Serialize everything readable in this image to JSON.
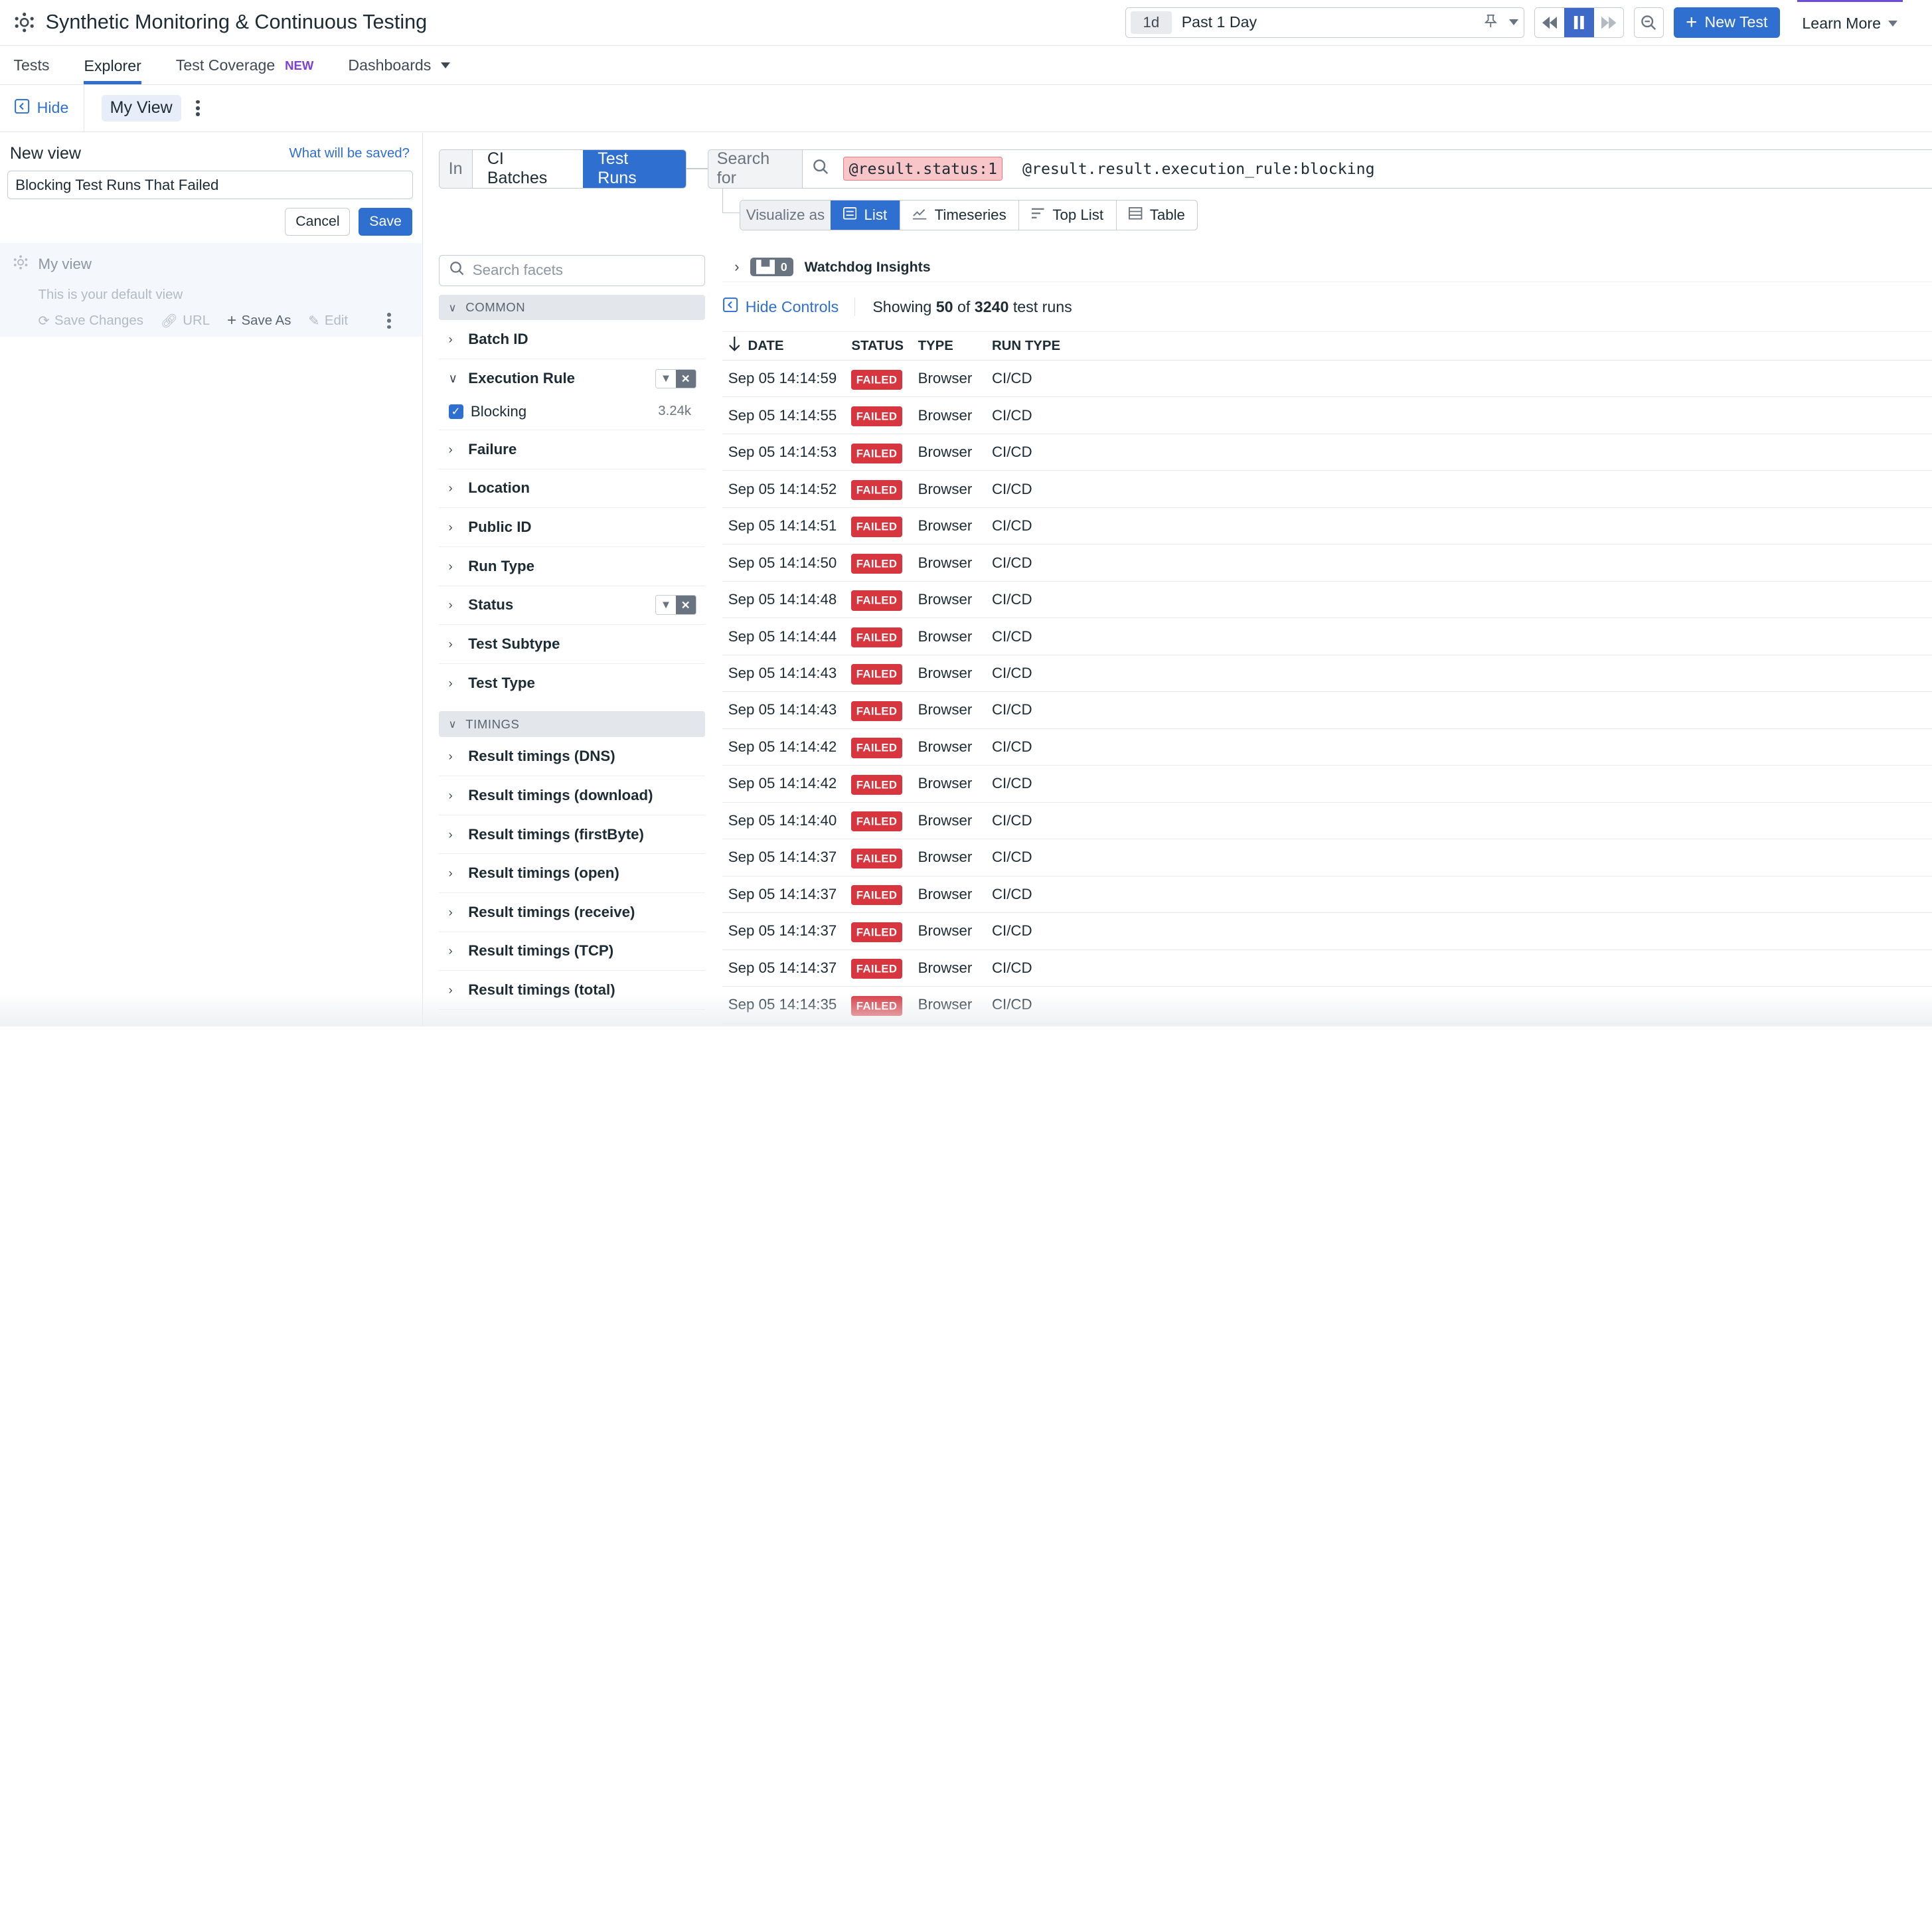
{
  "header": {
    "title": "Synthetic Monitoring & Continuous Testing",
    "time_badge": "1d",
    "time_label": "Past 1 Day",
    "new_test_label": "New Test",
    "learn_more_label": "Learn More"
  },
  "tabs": [
    {
      "label": "Tests"
    },
    {
      "label": "Explorer",
      "active": true
    },
    {
      "label": "Test Coverage",
      "badge": "NEW"
    },
    {
      "label": "Dashboards"
    }
  ],
  "viewbar": {
    "hide_label": "Hide",
    "view_name": "My View"
  },
  "new_view": {
    "title": "New view",
    "what_saved": "What will be saved?",
    "name_value": "Blocking Test Runs That Failed",
    "cancel_label": "Cancel",
    "save_label": "Save"
  },
  "saved_view": {
    "name": "My view",
    "description": "This is your default view",
    "actions": {
      "save_changes": "Save Changes",
      "url": "URL",
      "save_as": "Save As",
      "edit": "Edit"
    }
  },
  "query": {
    "in_label": "In",
    "scope_options": [
      "CI Batches",
      "Test Runs"
    ],
    "search_for_label": "Search for",
    "token_1": "@result.status:1",
    "token_2": "@result.result.execution_rule:blocking"
  },
  "visualize": {
    "label": "Visualize as",
    "options": [
      "List",
      "Timeseries",
      "Top List",
      "Table"
    ]
  },
  "facets": {
    "search_placeholder": "Search facets",
    "group_common": "COMMON",
    "group_timings": "TIMINGS",
    "common": [
      "Batch ID",
      "Execution Rule",
      "Failure",
      "Location",
      "Public ID",
      "Run Type",
      "Status",
      "Test Subtype",
      "Test Type"
    ],
    "execution_value": {
      "label": "Blocking",
      "count": "3.24k"
    },
    "timings": [
      "Result timings (DNS)",
      "Result timings (download)",
      "Result timings (firstByte)",
      "Result timings (open)",
      "Result timings (receive)",
      "Result timings (TCP)",
      "Result timings (total)"
    ]
  },
  "results": {
    "watchdog_count": "0",
    "watchdog_label": "Watchdog Insights",
    "hide_controls": "Hide Controls",
    "showing_prefix": "Showing",
    "showing_count": "50",
    "showing_of": "of",
    "showing_total": "3240",
    "showing_suffix": "test runs",
    "columns": {
      "date": "DATE",
      "status": "STATUS",
      "type": "TYPE",
      "run_type": "RUN TYPE"
    },
    "rows": [
      {
        "date": "Sep 05 14:14:59",
        "status": "FAILED",
        "type": "Browser",
        "run_type": "CI/CD"
      },
      {
        "date": "Sep 05 14:14:55",
        "status": "FAILED",
        "type": "Browser",
        "run_type": "CI/CD"
      },
      {
        "date": "Sep 05 14:14:53",
        "status": "FAILED",
        "type": "Browser",
        "run_type": "CI/CD"
      },
      {
        "date": "Sep 05 14:14:52",
        "status": "FAILED",
        "type": "Browser",
        "run_type": "CI/CD"
      },
      {
        "date": "Sep 05 14:14:51",
        "status": "FAILED",
        "type": "Browser",
        "run_type": "CI/CD"
      },
      {
        "date": "Sep 05 14:14:50",
        "status": "FAILED",
        "type": "Browser",
        "run_type": "CI/CD"
      },
      {
        "date": "Sep 05 14:14:48",
        "status": "FAILED",
        "type": "Browser",
        "run_type": "CI/CD"
      },
      {
        "date": "Sep 05 14:14:44",
        "status": "FAILED",
        "type": "Browser",
        "run_type": "CI/CD"
      },
      {
        "date": "Sep 05 14:14:43",
        "status": "FAILED",
        "type": "Browser",
        "run_type": "CI/CD"
      },
      {
        "date": "Sep 05 14:14:43",
        "status": "FAILED",
        "type": "Browser",
        "run_type": "CI/CD"
      },
      {
        "date": "Sep 05 14:14:42",
        "status": "FAILED",
        "type": "Browser",
        "run_type": "CI/CD"
      },
      {
        "date": "Sep 05 14:14:42",
        "status": "FAILED",
        "type": "Browser",
        "run_type": "CI/CD"
      },
      {
        "date": "Sep 05 14:14:40",
        "status": "FAILED",
        "type": "Browser",
        "run_type": "CI/CD"
      },
      {
        "date": "Sep 05 14:14:37",
        "status": "FAILED",
        "type": "Browser",
        "run_type": "CI/CD"
      },
      {
        "date": "Sep 05 14:14:37",
        "status": "FAILED",
        "type": "Browser",
        "run_type": "CI/CD"
      },
      {
        "date": "Sep 05 14:14:37",
        "status": "FAILED",
        "type": "Browser",
        "run_type": "CI/CD"
      },
      {
        "date": "Sep 05 14:14:37",
        "status": "FAILED",
        "type": "Browser",
        "run_type": "CI/CD"
      },
      {
        "date": "Sep 05 14:14:35",
        "status": "FAILED",
        "type": "Browser",
        "run_type": "CI/CD"
      }
    ]
  },
  "colors": {
    "accent": "#2f6fcf",
    "failed": "#d7363f",
    "new_badge": "#7c3fd9"
  }
}
